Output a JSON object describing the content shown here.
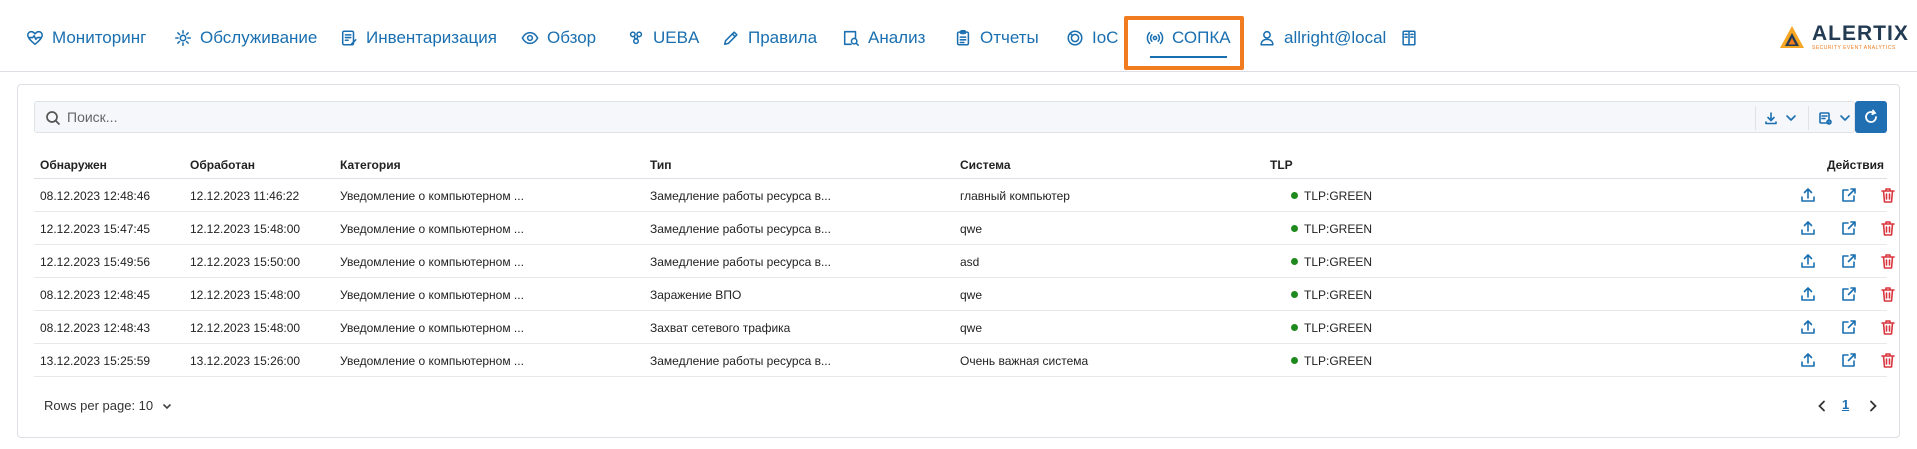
{
  "nav": {
    "items": [
      {
        "label": "Мониторинг",
        "icon": "heart-pulse-icon"
      },
      {
        "label": "Обслуживание",
        "icon": "gear-icon"
      },
      {
        "label": "Инвентаризация",
        "icon": "inventory-icon"
      },
      {
        "label": "Обзор",
        "icon": "eye-icon"
      },
      {
        "label": "UEBA",
        "icon": "users-icon"
      },
      {
        "label": "Правила",
        "icon": "pencil-icon"
      },
      {
        "label": "Анализ",
        "icon": "analysis-icon"
      },
      {
        "label": "Отчеты",
        "icon": "clipboard-icon"
      },
      {
        "label": "IoC",
        "icon": "ioc-icon"
      },
      {
        "label": "СОПКА",
        "icon": "broadcast-icon",
        "active": true
      },
      {
        "label": "allright@local",
        "icon": "user-icon"
      }
    ],
    "book_icon": "book-icon",
    "logo_text": "ALERTIX",
    "logo_subtext": "SECURITY EVENT ANALYTICS",
    "highlight_color": "#f07c1f",
    "accent_color": "#1a6fb0"
  },
  "search": {
    "placeholder": "Поиск...",
    "value": "",
    "export_icon": "download-icon",
    "columns_icon": "columns-settings-icon",
    "refresh_icon": "refresh-icon"
  },
  "table": {
    "columns": [
      "Обнаружен",
      "Обработан",
      "Категория",
      "Тип",
      "Система",
      "TLP",
      "Действия"
    ],
    "rows": [
      [
        "08.12.2023 12:48:46",
        "12.12.2023 11:46:22",
        "Уведомление о компьютерном ...",
        "Замедление работы ресурса в...",
        "главный компьютер",
        "TLP:GREEN"
      ],
      [
        "12.12.2023 15:47:45",
        "12.12.2023 15:48:00",
        "Уведомление о компьютерном ...",
        "Замедление работы ресурса в...",
        "qwe",
        "TLP:GREEN"
      ],
      [
        "12.12.2023 15:49:56",
        "12.12.2023 15:50:00",
        "Уведомление о компьютерном ...",
        "Замедление работы ресурса в...",
        "asd",
        "TLP:GREEN"
      ],
      [
        "08.12.2023 12:48:45",
        "12.12.2023 15:48:00",
        "Уведомление о компьютерном ...",
        "Заражение ВПО",
        "qwe",
        "TLP:GREEN"
      ],
      [
        "08.12.2023 12:48:43",
        "12.12.2023 15:48:00",
        "Уведомление о компьютерном ...",
        "Захват сетевого трафика",
        "qwe",
        "TLP:GREEN"
      ],
      [
        "13.12.2023 15:25:59",
        "13.12.2023 15:26:00",
        "Уведомление о компьютерном ...",
        "Замедление работы ресурса в...",
        "Очень важная система",
        "TLP:GREEN"
      ]
    ],
    "tlp_color": "#1e8a1e",
    "action_icons": [
      "upload-icon",
      "open-external-icon",
      "trash-icon"
    ],
    "delete_color": "#d9363e"
  },
  "footer": {
    "rows_per_page_label": "Rows per page: 10",
    "current_page": "1"
  }
}
